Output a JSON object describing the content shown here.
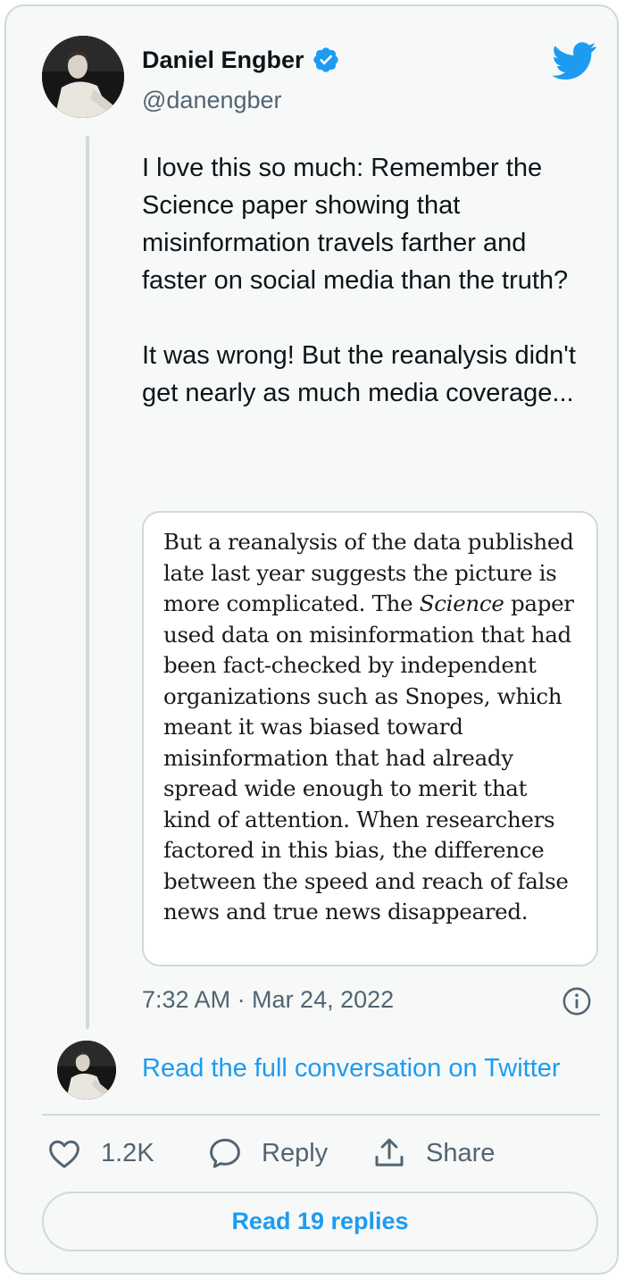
{
  "tweet": {
    "author_name": "Daniel Engber",
    "author_handle": "@danengber",
    "verified": true,
    "text_paragraphs": [
      "I love this so much: Remember the Science paper showing that misinformation travels farther and faster on social media than the truth?",
      "It was wrong! But the reanalysis didn't get nearly as much media coverage..."
    ],
    "timestamp": "7:32 AM · Mar 24, 2022"
  },
  "quote": {
    "before_italic": "But a reanalysis of the data published late last year suggests the picture is more complicated. The ",
    "italic": "Science",
    "after_italic": " paper used data on misinformation that had been fact-checked by independent organizations such as Snopes, which meant it was biased toward misinformation that had already spread wide enough to merit that kind of attention. When researchers factored in this bias, the difference between the speed and reach of false news and true news disappeared."
  },
  "thread": {
    "read_full_label": "Read the full conversation on Twitter"
  },
  "actions": {
    "like_count": "1.2K",
    "reply_label": "Reply",
    "share_label": "Share"
  },
  "replies_button_label": "Read 19 replies",
  "icons": {
    "brand": "twitter-bird-icon",
    "verified": "verified-badge-icon",
    "info": "info-icon",
    "like": "heart-icon",
    "reply": "speech-bubble-icon",
    "share": "share-arrow-icon"
  },
  "colors": {
    "accent": "#1d9bf0",
    "secondary_text": "#536471",
    "border": "#cfd9de",
    "background": "#f7f9f9"
  }
}
